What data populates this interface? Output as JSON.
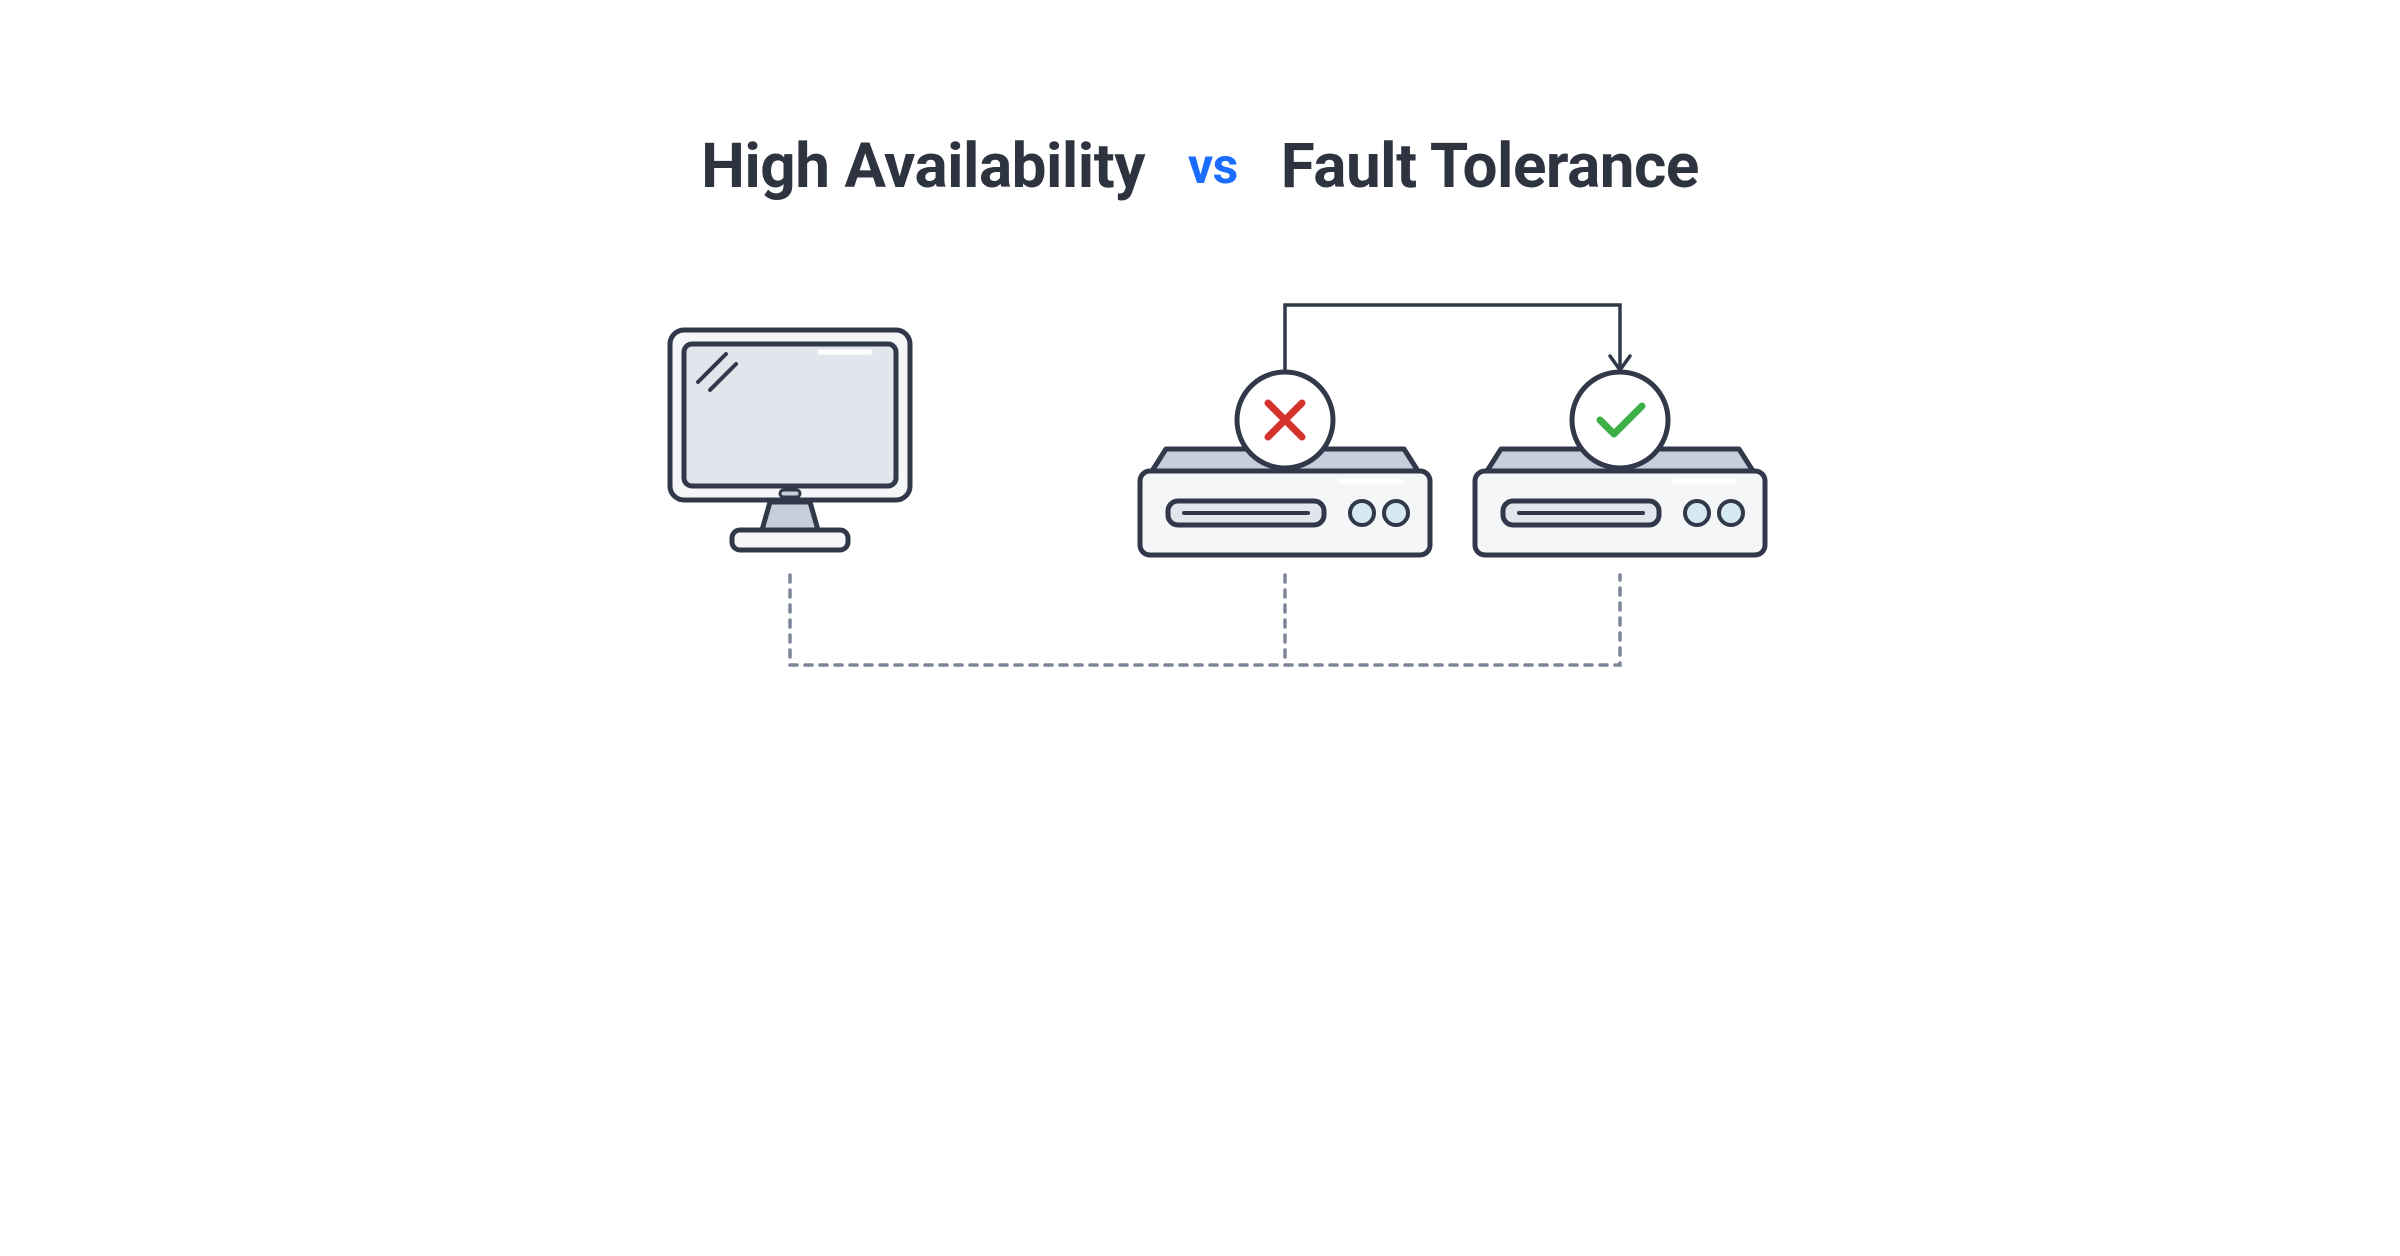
{
  "title": {
    "left": "High Availability",
    "mid": "vs",
    "right": "Fault Tolerance"
  },
  "icons": {
    "monitor": "monitor-icon",
    "serverFail": "server-fail-icon",
    "serverOk": "server-ok-icon",
    "fail": "x-icon",
    "ok": "check-icon",
    "failoverArrow": "failover-arrow",
    "network": "network-dashed-line"
  },
  "colors": {
    "stroke": "#30384A",
    "fillLight": "#F4F6F8",
    "fillMid": "#C6CEDB",
    "fillPanel": "#E2E6EC",
    "fillBadge": "#FFFFFF",
    "fail": "#D7332E",
    "ok": "#3CB047",
    "ledFill": "#D5E9F1",
    "ledStroke": "#30384A",
    "vs": "#1A6DFF",
    "title": "#2E3340",
    "dash": "#7D8599"
  },
  "positions": {
    "monitorX": 340,
    "server1X": 835,
    "server2X": 1170,
    "serverY": 472,
    "baselineY": 558,
    "networkY": 665
  }
}
